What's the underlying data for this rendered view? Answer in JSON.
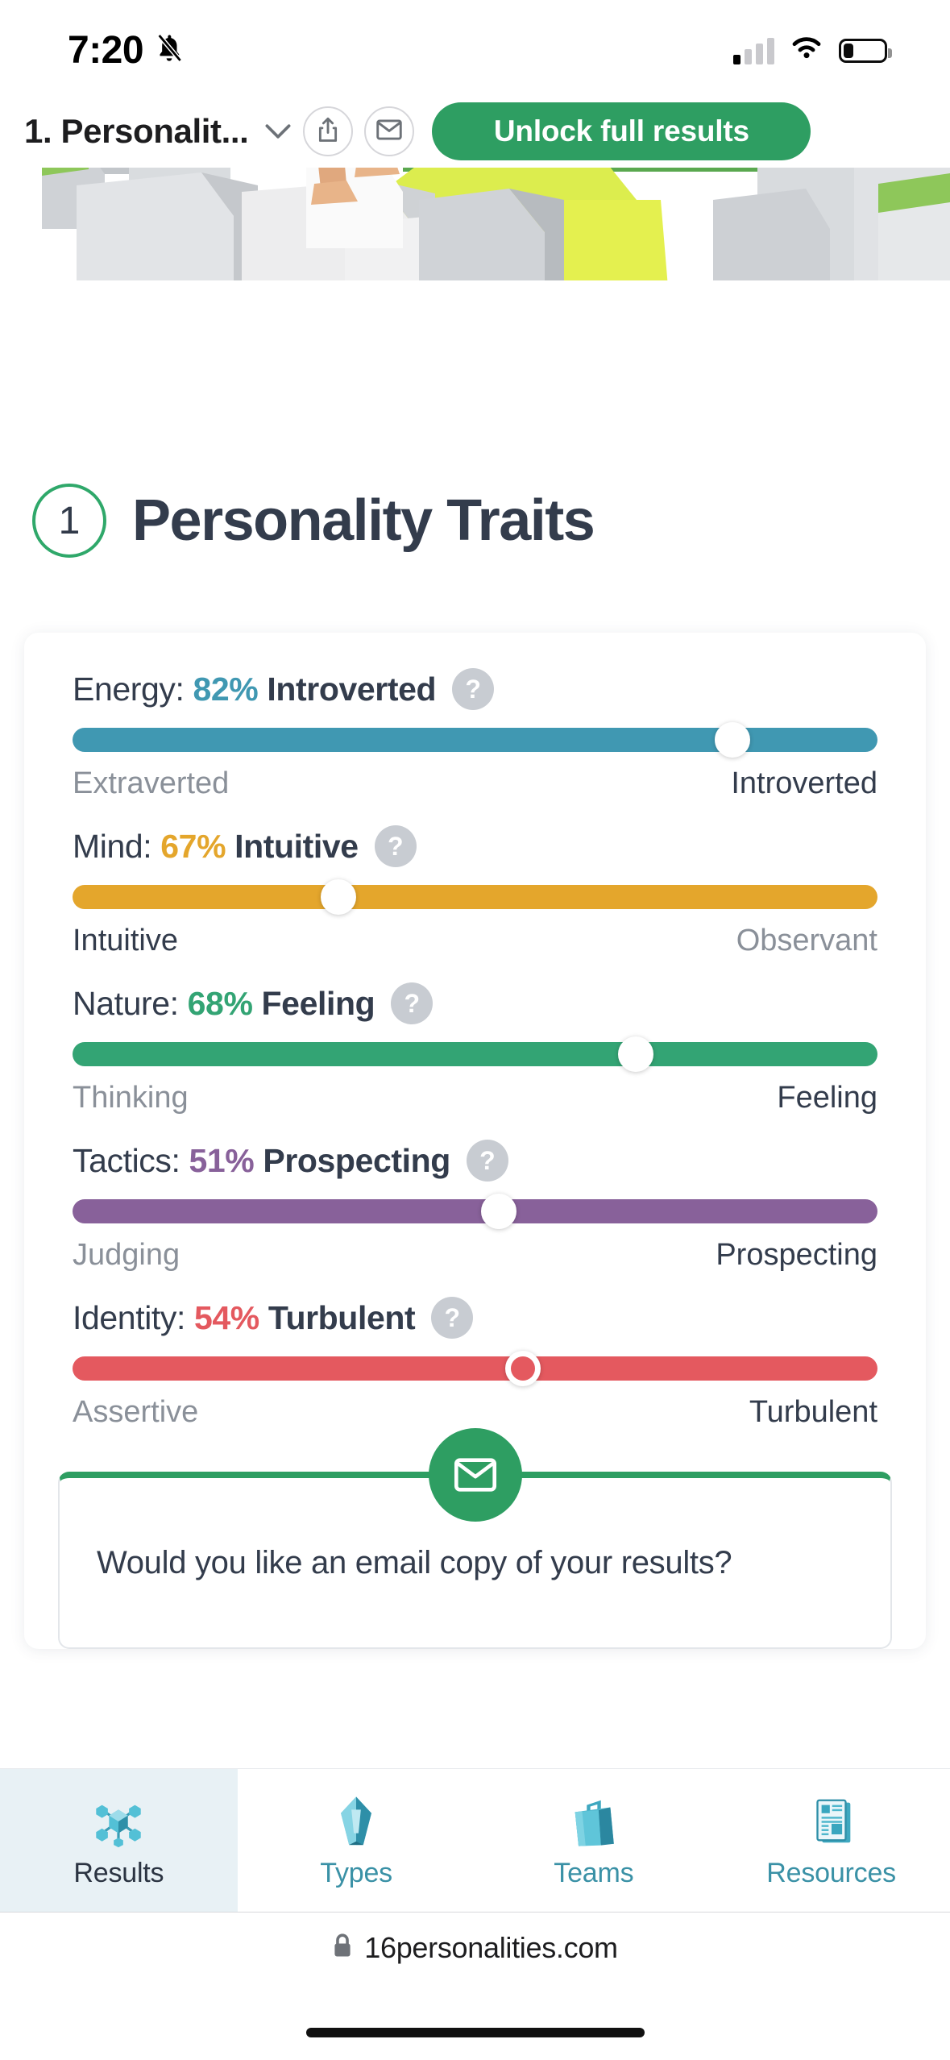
{
  "status_bar": {
    "time": "7:20",
    "silent_icon": "bell-slash-icon",
    "signal_icon": "cellular-signal-icon",
    "wifi_icon": "wifi-icon",
    "battery_icon": "battery-low-icon"
  },
  "app_bar": {
    "title": "1. Personalit...",
    "chevron_icon": "chevron-down-icon",
    "share_icon": "share-icon",
    "mail_icon": "envelope-icon",
    "unlock_label": "Unlock full results",
    "accent_green": "#2e9e62"
  },
  "page": {
    "number": "1",
    "title": "Personality Traits"
  },
  "traits": [
    {
      "name": "Energy",
      "label": "Energy:",
      "percent": "82%",
      "pole": "Introverted",
      "left_label": "Extraverted",
      "right_label": "Introverted",
      "value": 82,
      "active_side": "right",
      "color": "#4098b2",
      "help": "?"
    },
    {
      "name": "Mind",
      "label": "Mind:",
      "percent": "67%",
      "pole": "Intuitive",
      "left_label": "Intuitive",
      "right_label": "Observant",
      "value": 67,
      "active_side": "left",
      "color": "#e4a62c",
      "help": "?"
    },
    {
      "name": "Nature",
      "label": "Nature:",
      "percent": "68%",
      "pole": "Feeling",
      "left_label": "Thinking",
      "right_label": "Feeling",
      "value": 68,
      "active_side": "right",
      "color": "#33a474",
      "help": "?"
    },
    {
      "name": "Tactics",
      "label": "Tactics:",
      "percent": "51%",
      "pole": "Prospecting",
      "left_label": "Judging",
      "right_label": "Prospecting",
      "value": 51,
      "active_side": "right",
      "color": "#88619a",
      "help": "?"
    },
    {
      "name": "Identity",
      "label": "Identity:",
      "percent": "54%",
      "pole": "Turbulent",
      "left_label": "Assertive",
      "right_label": "Turbulent",
      "value": 54,
      "active_side": "right",
      "color": "#e4595f",
      "help": "?"
    }
  ],
  "email_card": {
    "icon": "envelope-icon",
    "question": "Would you like an email copy of your results?"
  },
  "tabs": [
    {
      "label": "Results",
      "icon": "molecule-icon",
      "active": true
    },
    {
      "label": "Types",
      "icon": "crystal-icon",
      "active": false
    },
    {
      "label": "Teams",
      "icon": "briefcase-icon",
      "active": false
    },
    {
      "label": "Resources",
      "icon": "documents-icon",
      "active": false
    }
  ],
  "browser": {
    "lock_icon": "lock-icon",
    "url": "16personalities.com"
  }
}
